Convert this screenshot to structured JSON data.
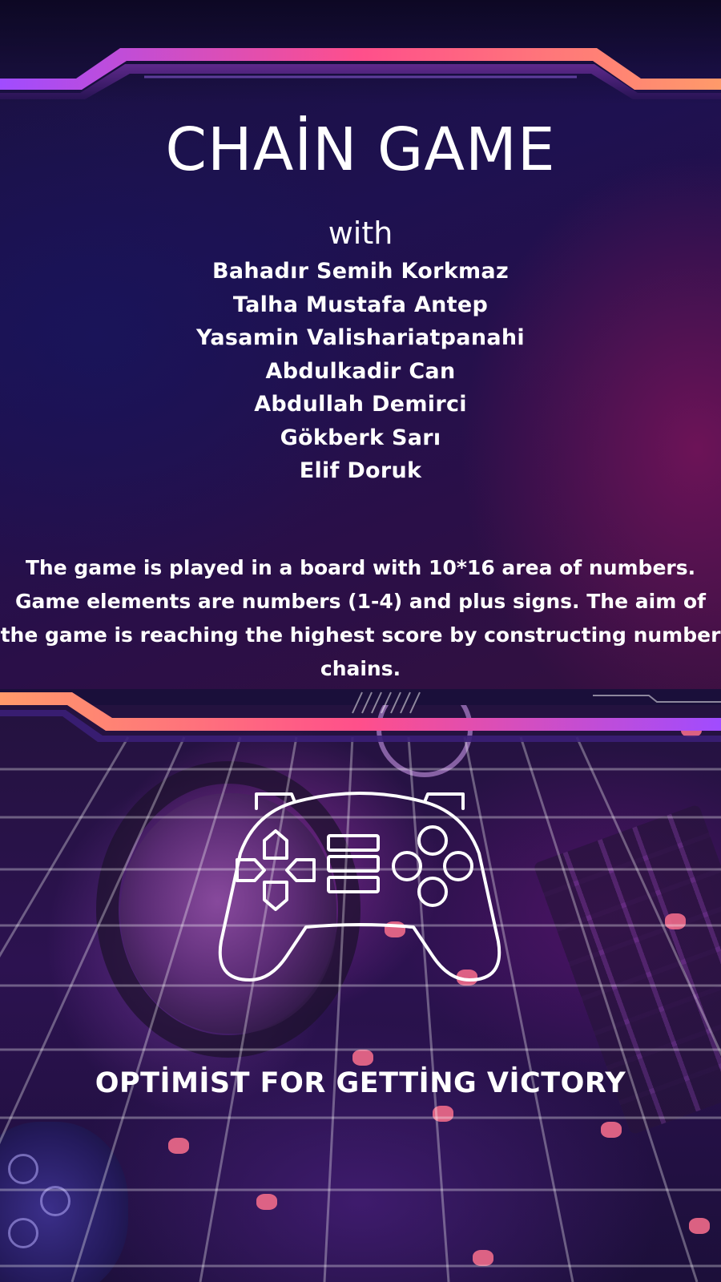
{
  "poster": {
    "title": "CHAİN GAME",
    "with_label": "with",
    "members": [
      "Bahadır Semih Korkmaz",
      "Talha Mustafa Antep",
      "Yasamin Valishariatpanahi",
      "Abdulkadir Can",
      "Abdullah Demirci",
      "Gökberk Sarı",
      "Elif Doruk"
    ],
    "description_lines": [
      "The game is played in a board with 10*16 area of numbers.",
      "Game elements are numbers (1-4) and plus signs. The aim of",
      "the game is reaching the highest score by constructing number",
      "chains."
    ],
    "slogan": "OPTİMİST FOR GETTİNG VİCTORY",
    "icons": {
      "hero": "game-controller-icon",
      "background": "gaming-desk-photo"
    },
    "colors": {
      "accent_pink": "#ff4f8b",
      "accent_orange": "#ff9a6a",
      "accent_violet": "#a04cff",
      "panel_dark": "#1e1150"
    }
  }
}
